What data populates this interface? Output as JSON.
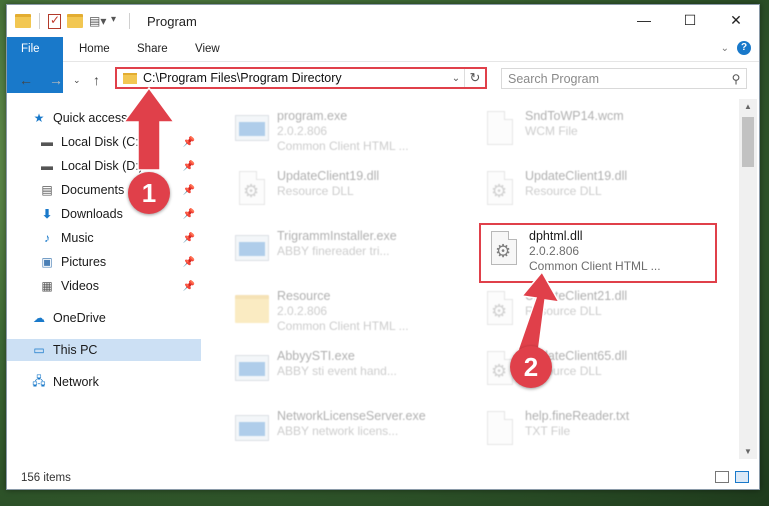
{
  "window": {
    "title": "Program",
    "controls": {
      "minimize": "—",
      "maximize": "☐",
      "close": "✕"
    }
  },
  "ribbon": {
    "tabs": [
      {
        "label": "File"
      },
      {
        "label": "Share"
      },
      {
        "label": "View"
      }
    ],
    "home": "Home"
  },
  "nav": {
    "address": "C:\\Program Files\\Program Directory",
    "search_placeholder": "Search Program"
  },
  "sidebar": {
    "items": [
      {
        "label": "Quick access",
        "icon": "star-icon",
        "pinned": false
      },
      {
        "label": "Local Disk (C:)",
        "icon": "drive-icon",
        "pinned": true
      },
      {
        "label": "Local Disk (D:)",
        "icon": "drive-icon",
        "pinned": true
      },
      {
        "label": "Documents",
        "icon": "documents-icon",
        "pinned": true
      },
      {
        "label": "Downloads",
        "icon": "download-icon",
        "pinned": true
      },
      {
        "label": "Music",
        "icon": "music-icon",
        "pinned": true
      },
      {
        "label": "Pictures",
        "icon": "pictures-icon",
        "pinned": true
      },
      {
        "label": "Videos",
        "icon": "videos-icon",
        "pinned": true
      },
      {
        "label": "OneDrive",
        "icon": "cloud-icon",
        "pinned": false
      },
      {
        "label": "This PC",
        "icon": "computer-icon",
        "pinned": false,
        "selected": true
      },
      {
        "label": "Network",
        "icon": "network-icon",
        "pinned": false
      }
    ]
  },
  "files": [
    {
      "name": "program.exe",
      "line2": "2.0.2.806",
      "line3": "Common Client HTML ...",
      "icon": "exe-icon"
    },
    {
      "name": "SndToWP14.wcm",
      "line2": "WCM File",
      "line3": "",
      "icon": "document-icon"
    },
    {
      "name": "UpdateClient19.dll",
      "line2": "Resource DLL",
      "line3": "",
      "icon": "dll-icon"
    },
    {
      "name": "UpdateClient19.dll",
      "line2": "Resource DLL",
      "line3": "",
      "icon": "dll-icon"
    },
    {
      "name": "TrigrammInstaller.exe",
      "line2": "ABBY finereader tri...",
      "line3": "",
      "icon": "app-icon"
    },
    {
      "name": "dphtml.dll",
      "line2": "2.0.2.806",
      "line3": "Common Client HTML ...",
      "icon": "dll-icon"
    },
    {
      "name": "Resource",
      "line2": "2.0.2.806",
      "line3": "Common Client HTML ...",
      "icon": "folder-icon"
    },
    {
      "name": "UpdateClient21.dll",
      "line2": "Resource DLL",
      "line3": "",
      "icon": "dll-icon"
    },
    {
      "name": "AbbyySTI.exe",
      "line2": "ABBY sti event hand...",
      "line3": "",
      "icon": "app-icon"
    },
    {
      "name": "UpdateClient65.dll",
      "line2": "Resource DLL",
      "line3": "",
      "icon": "dll-icon"
    },
    {
      "name": "NetworkLicenseServer.exe",
      "line2": "ABBY network licens...",
      "line3": "",
      "icon": "app-icon"
    },
    {
      "name": "help.fineReader.txt",
      "line2": "TXT File",
      "line3": "",
      "icon": "document-icon"
    }
  ],
  "status": {
    "items": "156 items"
  },
  "annotations": {
    "step1": "1",
    "step2": "2"
  },
  "colors": {
    "accent": "#1979ca",
    "highlight": "#e0404a",
    "selected": "#cce0f4"
  }
}
